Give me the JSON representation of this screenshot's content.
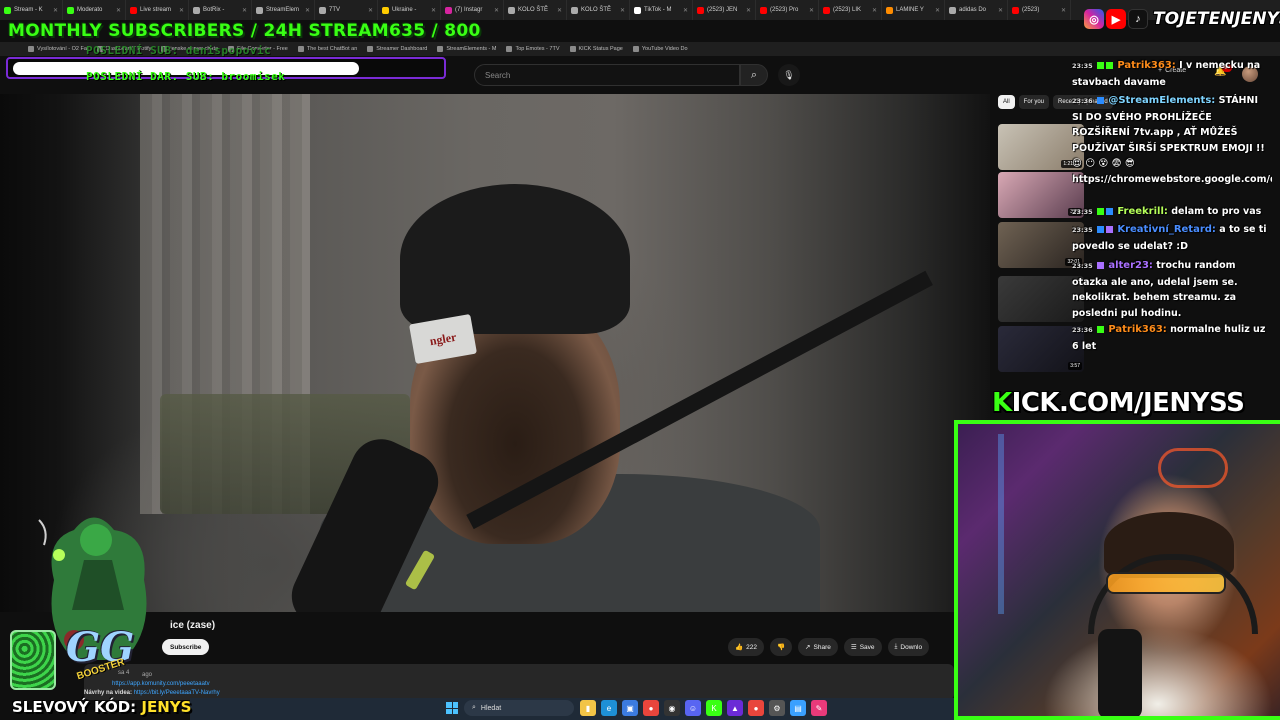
{
  "overlay": {
    "title": "MONTHLY SUBSCRIBERS / 24H STREAM635 / 800",
    "handle": "TOJETENJENYS",
    "last_sub": "POSLEDNÍ SUB: denispopovic",
    "last_donation": "POSLEDNÍ DAR. SUB: broomisek",
    "kick_prefix": "K",
    "kick_url": "ICK.COM/JENYSS",
    "promo_label": "SLEVOVÝ KÓD:",
    "promo_code": "JENYS",
    "sponsor_big": "GG",
    "sponsor_small": "BOOSTER"
  },
  "tabs": [
    {
      "label": "Stream - K",
      "color": "#39ff14"
    },
    {
      "label": "Moderato",
      "color": "#39ff14"
    },
    {
      "label": "Live stream",
      "color": "#ff0000"
    },
    {
      "label": "BotRix -",
      "color": "#aaaaaa"
    },
    {
      "label": "StreamElem",
      "color": "#aaaaaa"
    },
    {
      "label": "7TV",
      "color": "#aaaaaa"
    },
    {
      "label": "Ukraine -",
      "color": "#ffcc00"
    },
    {
      "label": "(7) Instagr",
      "color": "#d6249f"
    },
    {
      "label": "KOLO ŠTĚ",
      "color": "#aaaaaa"
    },
    {
      "label": "KOLO ŠTĚ",
      "color": "#aaaaaa"
    },
    {
      "label": "TikTok - M",
      "color": "#ffffff"
    },
    {
      "label": "(2523) JEN",
      "color": "#ff0000"
    },
    {
      "label": "(2523) Pro",
      "color": "#ff0000"
    },
    {
      "label": "(2523) LIK",
      "color": "#ff0000"
    },
    {
      "label": "LAMINE Y",
      "color": "#ff8c00"
    },
    {
      "label": "adidas Do",
      "color": "#aaaaaa"
    },
    {
      "label": "(2523)",
      "color": "#ff0000"
    }
  ],
  "bookmarks": [
    "Vysílotování - O2 Fa",
    "Dashboard | Hotify",
    "jenske server chata",
    "File Converter - Free",
    "The best ChatBot an",
    "Streamer Dashboard",
    "StreamElements - M",
    "Top Emotes - 7TV",
    "KICK Status Page",
    "YouTube Video Do"
  ],
  "youtube": {
    "search_placeholder": "Search",
    "create_label": "Create",
    "notif_count": "9+",
    "chips": [
      "All",
      "For you",
      "Recently uploaded"
    ],
    "video_title": "ice (zase)",
    "subscribe_label": "Subscribe",
    "like_count": "222",
    "share_label": "Share",
    "save_label": "Save",
    "download_label": "Downlo",
    "desc_views": "sa 4",
    "desc_ago": "ago",
    "desc_link1": "https://app.komunity.com/peeetaaatv",
    "desc_prefix": "Návrhy na videa: ",
    "desc_link2": "https://bit.ly/PeeetaaaTV-Navrhy",
    "recommended": [
      {
        "duration": "1:21:12",
        "colors": [
          "#c8c2b5",
          "#8b7d6b"
        ]
      },
      {
        "duration": "3:23",
        "colors": [
          "#d8a8b4",
          "#5a3d4f"
        ]
      },
      {
        "duration": "32:01",
        "colors": [
          "#6f6253",
          "#2a2420"
        ]
      },
      {
        "duration": "",
        "colors": [
          "#3a3a3a",
          "#1a1a1a"
        ]
      },
      {
        "duration": "3:57",
        "colors": [
          "#2a2a3a",
          "#121218"
        ]
      }
    ]
  },
  "chat": {
    "messages": [
      {
        "time": "23:35",
        "user": "Patrik363:",
        "user_color": "#ff8c1a",
        "text": " I v nemecku na stavbach davame"
      },
      {
        "time": "23:36",
        "user": "@StreamElements:",
        "user_color": "#7fd4ff",
        "text": " STÁHNI SI DO SVÉHO PROHLÍŽEČE ROZŠÍŘENÍ 7tv.app , AŤ MŮŽEŠ POUŽÍVAT ŠIRŠÍ SPEKTRUM EMOJI !! 😍 😶 😵 😨 😎 https://chromewebstore.google.com/detail/7tv/ammjkodgmmoknidbanneddgankgfejfh"
      },
      {
        "time": "23:35",
        "user": "Freekrill:",
        "user_color": "#b6ff5a",
        "text": " delam to pro vas"
      },
      {
        "time": "23:35",
        "user": "Kreativní_Retard:",
        "user_color": "#4a8dff",
        "text": " a to se ti povedlo se udelat? :D"
      },
      {
        "time": "23:35",
        "user": "alter23:",
        "user_color": "#a970ff",
        "text": " trochu random otazka ale ano, udelal jsem se. nekolikrat. behem streamu. za posledni pul hodinu."
      },
      {
        "time": "23:36",
        "user": "Patrik363:",
        "user_color": "#ff8c1a",
        "text": " normalne huliz uz 6 let"
      }
    ]
  },
  "taskbar": {
    "search_placeholder": "Hledat",
    "icons": [
      {
        "name": "file-explorer-icon",
        "color": "#f2c447",
        "glyph": "▮"
      },
      {
        "name": "edge-icon",
        "color": "#1e90d6",
        "glyph": "e"
      },
      {
        "name": "store-icon",
        "color": "#3b7be0",
        "glyph": "▣"
      },
      {
        "name": "chrome-icon",
        "color": "#e8453c",
        "glyph": "●"
      },
      {
        "name": "obs-icon",
        "color": "#333333",
        "glyph": "◉"
      },
      {
        "name": "discord-icon",
        "color": "#5865f2",
        "glyph": "☺"
      },
      {
        "name": "kick-icon",
        "color": "#39ff14",
        "glyph": "K"
      },
      {
        "name": "app-icon",
        "color": "#6b2bd6",
        "glyph": "▲"
      },
      {
        "name": "chrome-profile-icon",
        "color": "#e8453c",
        "glyph": "●"
      },
      {
        "name": "settings-icon",
        "color": "#555555",
        "glyph": "⚙"
      },
      {
        "name": "notes-icon",
        "color": "#3aa0ff",
        "glyph": "▤"
      },
      {
        "name": "pin-icon",
        "color": "#e83a7a",
        "glyph": "✎"
      }
    ]
  }
}
